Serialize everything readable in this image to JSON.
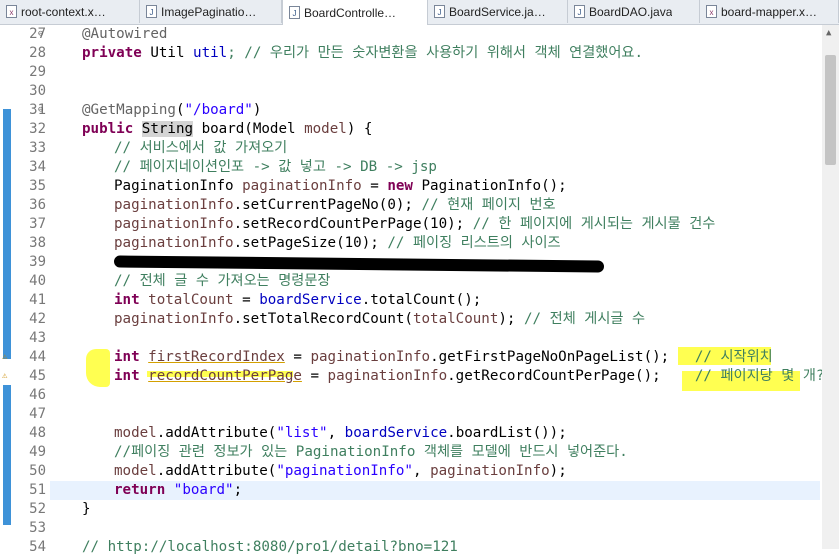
{
  "tabs": [
    {
      "label": "root-context.x…",
      "icon": "xml-file-icon",
      "active": false
    },
    {
      "label": "ImagePaginatio…",
      "icon": "java-file-icon",
      "active": false
    },
    {
      "label": "BoardControlle…",
      "icon": "java-file-icon",
      "active": true
    },
    {
      "label": "BoardService.ja…",
      "icon": "java-file-icon",
      "active": false
    },
    {
      "label": "BoardDAO.java",
      "icon": "java-file-icon",
      "active": false
    },
    {
      "label": "board-mapper.x…",
      "icon": "xml-file-icon",
      "active": false
    }
  ],
  "line_numbers": [
    "27",
    "28",
    "29",
    "30",
    "31",
    "32",
    "33",
    "34",
    "35",
    "36",
    "37",
    "38",
    "39",
    "40",
    "41",
    "42",
    "43",
    "44",
    "45",
    "46",
    "47",
    "48",
    "49",
    "50",
    "51",
    "52",
    "53",
    "54"
  ],
  "code": {
    "l27": "@Autowired",
    "l28_kw": "private",
    "l28_rest": " Util ",
    "l28_field": "util",
    "l28_comment": "; // 우리가 만든 숫자변환을 사용하기 위해서 객체 연결했어요.",
    "l31_ann": "@GetMapping",
    "l31_str": "\"/board\"",
    "l32_kw": "public",
    "l32_type": "String",
    "l32_rest": " board(Model ",
    "l32_param": "model",
    "l32_end": ") {",
    "l33": "// 서비스에서 값 가져오기",
    "l34": "// 페이지네이션인포 -> 값 넣고 -> DB -> jsp",
    "l35_a": "PaginationInfo ",
    "l35_b": "paginationInfo",
    "l35_c": " = ",
    "l35_kw": "new",
    "l35_d": " PaginationInfo();",
    "l36_a": "paginationInfo",
    "l36_b": ".setCurrentPageNo(0); ",
    "l36_cm": "// 현재 페이지 번호",
    "l37_a": "paginationInfo",
    "l37_b": ".setRecordCountPerPage(10); ",
    "l37_cm": "// 한 페이지에 게시되는 게시물 건수",
    "l38_a": "paginationInfo",
    "l38_b": ".setPageSize(10); ",
    "l38_cm": "// 페이징 리스트의 사이즈",
    "l40": "// 전체 글 수 가져오는 명령문장",
    "l41_kw": "int",
    "l41_a": " totalCount",
    "l41_b": " = ",
    "l41_c": "boardService",
    "l41_d": ".totalCount();",
    "l42_a": "paginationInfo",
    "l42_b": ".setTotalRecordCount(",
    "l42_c": "totalCount",
    "l42_d": "); ",
    "l42_cm": "// 전체 게시글 수",
    "l44_kw": "int",
    "l44_var": "firstRecordIndex",
    "l44_b": " = ",
    "l44_c": "paginationInfo",
    "l44_d": ".getFirstPageNoOnPageList();   ",
    "l44_cm": "// 시작위치",
    "l45_kw": "int",
    "l45_var": "recordCountPerPage",
    "l45_b": " = ",
    "l45_c": "paginationInfo",
    "l45_d": ".getRecordCountPerPage();    ",
    "l45_cm": "// 페이지당 몇 개?",
    "l48_a": "model",
    "l48_b": ".addAttribute(",
    "l48_str": "\"list\"",
    "l48_c": ", ",
    "l48_d": "boardService",
    "l48_e": ".boardList());",
    "l49": "//페이징 관련 정보가 있는 PaginationInfo 객체를 모델에 반드시 넣어준다.",
    "l50_a": "model",
    "l50_b": ".addAttribute(",
    "l50_str": "\"paginationInfo\"",
    "l50_c": ", ",
    "l50_d": "paginationInfo",
    "l50_e": ");",
    "l51_kw": "return",
    "l51_str": "\"board\"",
    "l51_end": ";",
    "l52": "}",
    "l54": "// http://localhost:8080/pro1/detail?bno=121"
  }
}
